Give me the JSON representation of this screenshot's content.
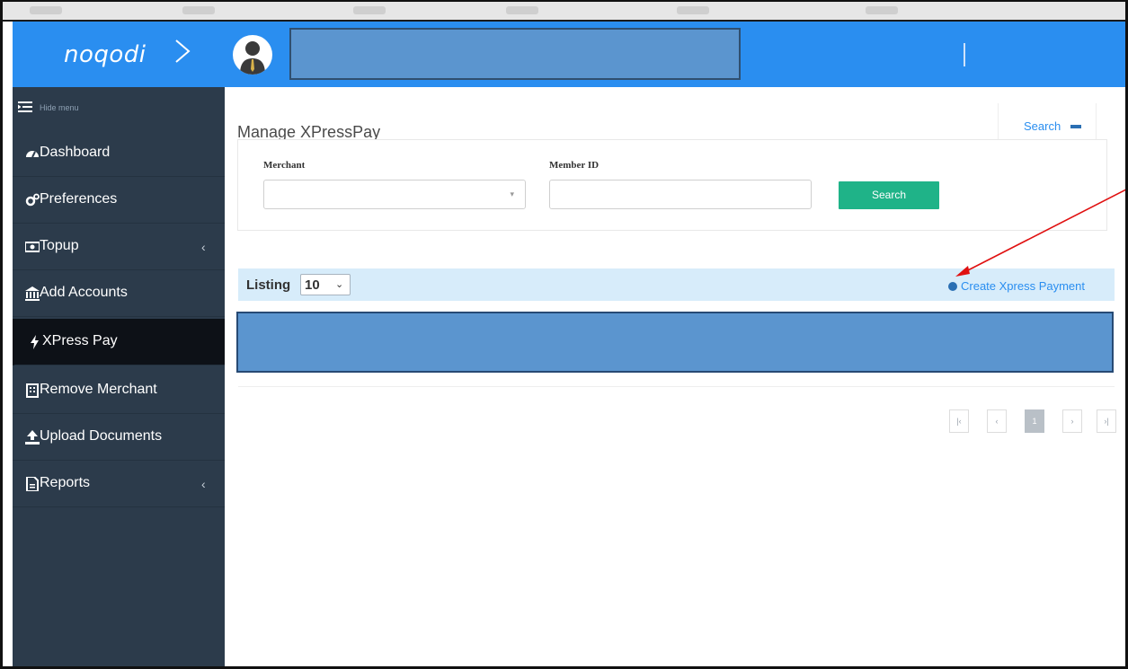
{
  "brand": {
    "logo_text": "noqodi"
  },
  "sidebar": {
    "hide_menu_label": "Hide menu",
    "items": [
      {
        "label": "Dashboard",
        "icon": "dashboard-icon",
        "has_caret": false
      },
      {
        "label": "Preferences",
        "icon": "cogs-icon",
        "has_caret": false
      },
      {
        "label": "Topup",
        "icon": "money-icon",
        "has_caret": true
      },
      {
        "label": "Add Accounts",
        "icon": "bank-icon",
        "has_caret": false
      },
      {
        "label": "XPress Pay",
        "icon": "bolt-icon",
        "has_caret": false,
        "active": true
      },
      {
        "label": "Remove Merchant",
        "icon": "building-icon",
        "has_caret": false
      },
      {
        "label": "Upload Documents",
        "icon": "upload-icon",
        "has_caret": false
      },
      {
        "label": "Reports",
        "icon": "file-icon",
        "has_caret": true
      }
    ],
    "caret_glyph": "‹"
  },
  "main": {
    "title": "Manage XPressPay",
    "search_tab_label": "Search",
    "filters": {
      "merchant_label": "Merchant",
      "merchant_value": "",
      "member_id_label": "Member ID",
      "member_id_value": "",
      "search_button": "Search"
    },
    "listing": {
      "label": "Listing",
      "page_size": "10",
      "create_link": "Create Xpress Payment"
    },
    "pagination": {
      "first": "|‹",
      "prev": "‹",
      "current": "1",
      "next": "›",
      "last": "›|"
    }
  },
  "colors": {
    "header_blue": "#2a8ef0",
    "sidebar_bg": "#2c3b4b",
    "active_item_bg": "#0d1117",
    "search_button": "#1fb388",
    "listing_bar_bg": "#d7ecfa",
    "redaction_box": "#5b95cf",
    "annotation_arrow": "#e01010"
  }
}
